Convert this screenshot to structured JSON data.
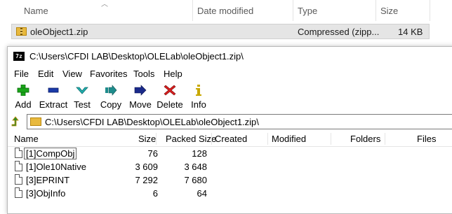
{
  "explorer": {
    "columns": {
      "name": "Name",
      "date_modified": "Date modified",
      "type": "Type",
      "size": "Size"
    },
    "row": {
      "name": "oleObject1.zip",
      "type": "Compressed (zipp...",
      "size": "14 KB"
    }
  },
  "window": {
    "title": "C:\\Users\\CFDI LAB\\Desktop\\OLELab\\oleObject1.zip\\",
    "app_icon_text": "7z",
    "menu": [
      "File",
      "Edit",
      "View",
      "Favorites",
      "Tools",
      "Help"
    ],
    "toolbar": [
      {
        "label": "Add",
        "icon": "plus-icon",
        "color": "#1aa51a"
      },
      {
        "label": "Extract",
        "icon": "minus-icon",
        "color": "#1a3aa8"
      },
      {
        "label": "Test",
        "icon": "check-icon",
        "color": "#20b0b0"
      },
      {
        "label": "Copy",
        "icon": "copy-arrow-icon",
        "color": "#1e8c8c"
      },
      {
        "label": "Move",
        "icon": "move-arrow-icon",
        "color": "#1a2a8a"
      },
      {
        "label": "Delete",
        "icon": "delete-x-icon",
        "color": "#d81e1e"
      },
      {
        "label": "Info",
        "icon": "info-icon",
        "color": "#c8a800"
      }
    ],
    "address": "C:\\Users\\CFDI LAB\\Desktop\\OLELab\\oleObject1.zip\\",
    "list": {
      "columns": [
        "Name",
        "Size",
        "Packed Size",
        "Created",
        "Modified",
        "Folders",
        "Files"
      ],
      "rows": [
        {
          "name": "[1]CompObj",
          "size": "76",
          "packed": "128"
        },
        {
          "name": "[1]Ole10Native",
          "size": "3 609",
          "packed": "3 648"
        },
        {
          "name": "[3]EPRINT",
          "size": "7 292",
          "packed": "7 680"
        },
        {
          "name": "[3]ObjInfo",
          "size": "6",
          "packed": "64"
        }
      ]
    }
  }
}
